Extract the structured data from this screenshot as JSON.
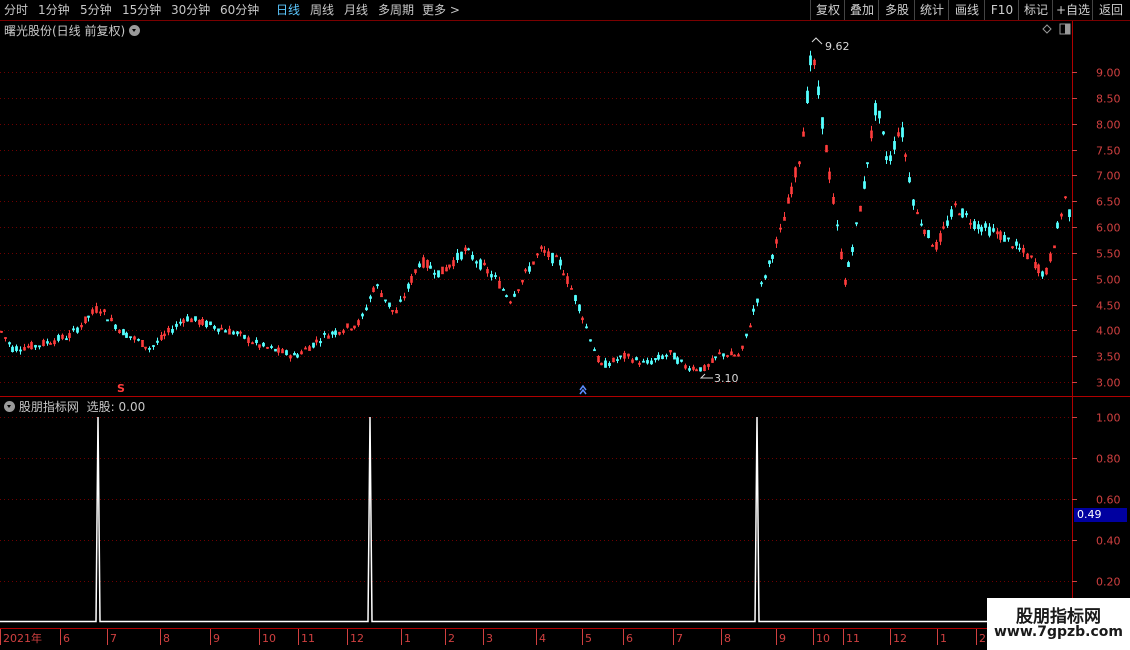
{
  "toolbar": {
    "periods": [
      "分时",
      "1分钟",
      "5分钟",
      "15分钟",
      "30分钟",
      "60分钟",
      "日线",
      "周线",
      "月线",
      "多周期",
      "更多"
    ],
    "active_period": "日线",
    "right_buttons": [
      "复权",
      "叠加",
      "多股",
      "统计",
      "画线",
      "F10",
      "标记",
      "+自选",
      "返回"
    ]
  },
  "main_chart": {
    "title": "曙光股份(日线 前复权)",
    "high_label": "9.62",
    "low_label": "3.10",
    "y_ticks": [
      "9.00",
      "8.50",
      "8.00",
      "7.50",
      "7.00",
      "6.50",
      "6.00",
      "5.50",
      "5.00",
      "4.50",
      "4.00",
      "3.50",
      "3.00"
    ],
    "markers": [
      "S",
      "B"
    ]
  },
  "indicator": {
    "title": "股朋指标网",
    "value_label": "选股: 0.00",
    "current_value": "0.49",
    "y_ticks": [
      "1.00",
      "0.80",
      "0.60",
      "0.40",
      "0.20"
    ]
  },
  "x_axis": {
    "labels": [
      "2021年",
      "6",
      "7",
      "8",
      "9",
      "10",
      "11",
      "12",
      "1",
      "2",
      "3",
      "4",
      "5",
      "6",
      "7",
      "8",
      "9",
      "10",
      "11",
      "12",
      "1",
      "2"
    ]
  },
  "watermark": {
    "line1": "股朋指标网",
    "line2": "www.7gpzb.com"
  },
  "colors": {
    "up": "#ff3c3c",
    "down": "#54ffff",
    "grid": "#6e0000",
    "axis": "#d04040",
    "active": "#5cc8ff",
    "signal": "#ffffff"
  },
  "chart_data": [
    {
      "type": "candlestick",
      "title": "曙光股份(日线 前复权)",
      "ylim": [
        2.8,
        10.2
      ],
      "y_ticks": [
        3.0,
        3.5,
        4.0,
        4.5,
        5.0,
        5.5,
        6.0,
        6.5,
        7.0,
        7.5,
        8.0,
        8.5,
        9.0
      ],
      "high_annotation": 9.62,
      "low_annotation": 3.1,
      "price_path": [
        [
          0,
          4.0
        ],
        [
          12,
          3.65
        ],
        [
          35,
          3.7
        ],
        [
          70,
          3.9
        ],
        [
          98,
          4.45
        ],
        [
          120,
          4.0
        ],
        [
          150,
          3.65
        ],
        [
          185,
          4.25
        ],
        [
          235,
          3.95
        ],
        [
          260,
          3.7
        ],
        [
          295,
          3.5
        ],
        [
          325,
          3.9
        ],
        [
          360,
          4.15
        ],
        [
          375,
          4.9
        ],
        [
          395,
          4.3
        ],
        [
          420,
          5.35
        ],
        [
          440,
          5.1
        ],
        [
          465,
          5.55
        ],
        [
          495,
          5.0
        ],
        [
          510,
          4.6
        ],
        [
          540,
          5.55
        ],
        [
          560,
          5.3
        ],
        [
          580,
          4.4
        ],
        [
          600,
          3.3
        ],
        [
          625,
          3.5
        ],
        [
          645,
          3.35
        ],
        [
          670,
          3.55
        ],
        [
          685,
          3.3
        ],
        [
          705,
          3.25
        ],
        [
          720,
          3.55
        ],
        [
          740,
          3.5
        ],
        [
          760,
          4.8
        ],
        [
          780,
          5.9
        ],
        [
          800,
          7.4
        ],
        [
          812,
          9.45
        ],
        [
          822,
          8.0
        ],
        [
          845,
          4.9
        ],
        [
          862,
          6.6
        ],
        [
          876,
          8.4
        ],
        [
          888,
          7.2
        ],
        [
          900,
          8.0
        ],
        [
          915,
          6.3
        ],
        [
          935,
          5.6
        ],
        [
          955,
          6.4
        ],
        [
          975,
          6.05
        ],
        [
          1000,
          5.85
        ],
        [
          1030,
          5.4
        ],
        [
          1045,
          5.05
        ],
        [
          1065,
          6.55
        ],
        [
          1073,
          6.0
        ]
      ]
    },
    {
      "type": "line",
      "title": "股朋指标网",
      "ylim": [
        0,
        1.05
      ],
      "y_ticks": [
        0.2,
        0.4,
        0.6,
        0.8,
        1.0
      ],
      "baseline": 0,
      "spikes_at_month": [
        "2021-07",
        "2021-12",
        "2022-08"
      ],
      "spike_value": 1.0
    }
  ]
}
